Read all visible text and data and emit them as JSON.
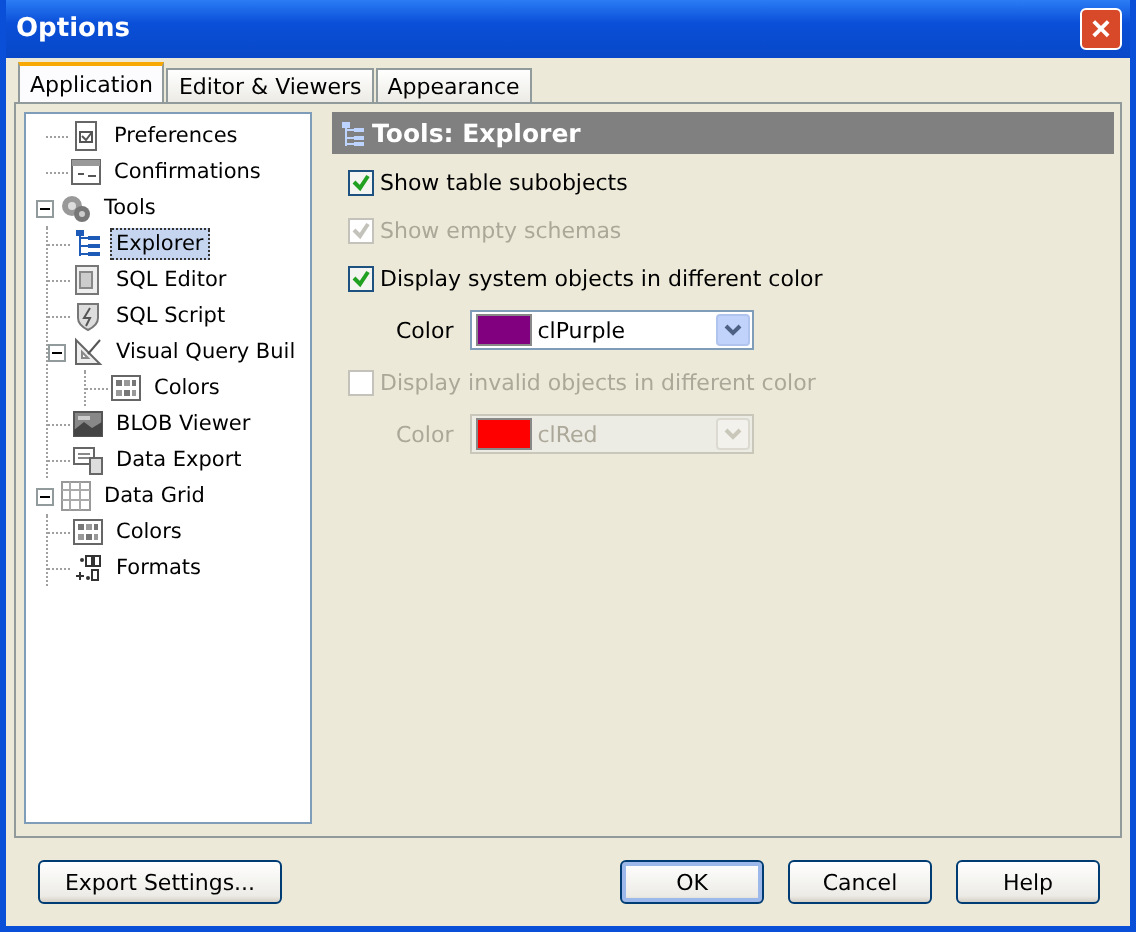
{
  "window": {
    "title": "Options",
    "close": "×"
  },
  "tabs": [
    {
      "label": "Application",
      "selected": true
    },
    {
      "label": "Editor & Viewers",
      "selected": false
    },
    {
      "label": "Appearance",
      "selected": false
    }
  ],
  "tree": [
    {
      "label": "Preferences",
      "selected": false
    },
    {
      "label": "Confirmations",
      "selected": false
    },
    {
      "label": "Tools",
      "selected": false,
      "expanded": true,
      "children": [
        {
          "label": "Explorer",
          "selected": true
        },
        {
          "label": "SQL Editor",
          "selected": false
        },
        {
          "label": "SQL Script",
          "selected": false
        },
        {
          "label": "Visual Query Buil",
          "selected": false,
          "expanded": true,
          "children": [
            {
              "label": "Colors",
              "selected": false
            }
          ]
        },
        {
          "label": "BLOB Viewer",
          "selected": false
        },
        {
          "label": "Data Export",
          "selected": false
        }
      ]
    },
    {
      "label": "Data Grid",
      "selected": false,
      "expanded": true,
      "children": [
        {
          "label": "Colors",
          "selected": false
        },
        {
          "label": "Formats",
          "selected": false
        }
      ]
    }
  ],
  "section": {
    "title": "Tools: Explorer"
  },
  "options": [
    {
      "kind": "checkbox",
      "label": "Show table subobjects",
      "checked": true,
      "disabled": false
    },
    {
      "kind": "checkbox",
      "label": "Show empty schemas",
      "checked": true,
      "disabled": true
    },
    {
      "kind": "checkbox",
      "label": "Display system objects in different color",
      "checked": true,
      "disabled": false
    },
    {
      "kind": "color",
      "label": "Color",
      "value": "clPurple",
      "color": "#800080",
      "disabled": false
    },
    {
      "kind": "checkbox",
      "label": "Display invalid objects in different color",
      "checked": false,
      "disabled": true
    },
    {
      "kind": "color",
      "label": "Color",
      "value": "clRed",
      "color": "#ff0000",
      "disabled": true
    }
  ],
  "buttons": [
    {
      "label": "Export Settings...",
      "default": false
    },
    {
      "label": "OK",
      "default": true
    },
    {
      "label": "Cancel",
      "default": false
    },
    {
      "label": "Help",
      "default": false
    }
  ]
}
